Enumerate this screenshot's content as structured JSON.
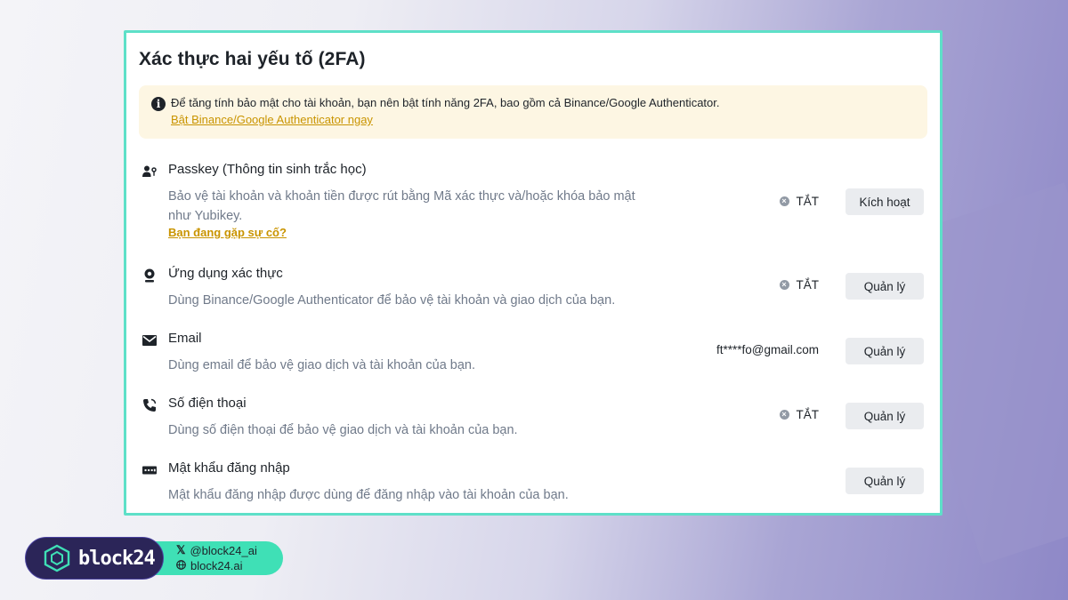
{
  "title": "Xác thực hai yếu tố (2FA)",
  "notice": {
    "message": "Để tăng tính bảo mật cho tài khoản, bạn nên bật tính năng 2FA, bao gồm cả Binance/Google Authenticator.",
    "link": "Bật Binance/Google Authenticator ngay"
  },
  "methods": [
    {
      "icon": "passkey-icon",
      "title": "Passkey (Thông tin sinh trắc học)",
      "description": "Bảo vệ tài khoản và khoản tiền được rút bằng Mã xác thực và/hoặc khóa bảo mật như Yubikey.",
      "help_link": "Bạn đang gặp sự cố?",
      "status": "TẮT",
      "button": "Kích hoạt"
    },
    {
      "icon": "authenticator-icon",
      "title": "Ứng dụng xác thực",
      "description": "Dùng Binance/Google Authenticator để bảo vệ tài khoản và giao dịch của bạn.",
      "status": "TẮT",
      "button": "Quản lý"
    },
    {
      "icon": "envelope-icon",
      "title": "Email",
      "description": "Dùng email để bảo vệ giao dịch và tài khoản của bạn.",
      "value": "ft****fo@gmail.com",
      "button": "Quản lý"
    },
    {
      "icon": "phone-icon",
      "title": "Số điện thoại",
      "description": "Dùng số điện thoại để bảo vệ giao dịch và tài khoản của bạn.",
      "status": "TẮT",
      "button": "Quản lý"
    },
    {
      "icon": "password-icon",
      "title": "Mật khẩu đăng nhập",
      "description": "Mật khẩu đăng nhập được dùng để đăng nhập vào tài khoản của bạn.",
      "button": "Quản lý"
    }
  ],
  "watermark": {
    "brand": "block24",
    "twitter": "@block24_ai",
    "website": "block24.ai"
  },
  "colors": {
    "accent_link": "#c99400",
    "card_border": "#5ee0c8",
    "notice_bg": "#fdf6e3",
    "button_bg": "#eaecef"
  }
}
